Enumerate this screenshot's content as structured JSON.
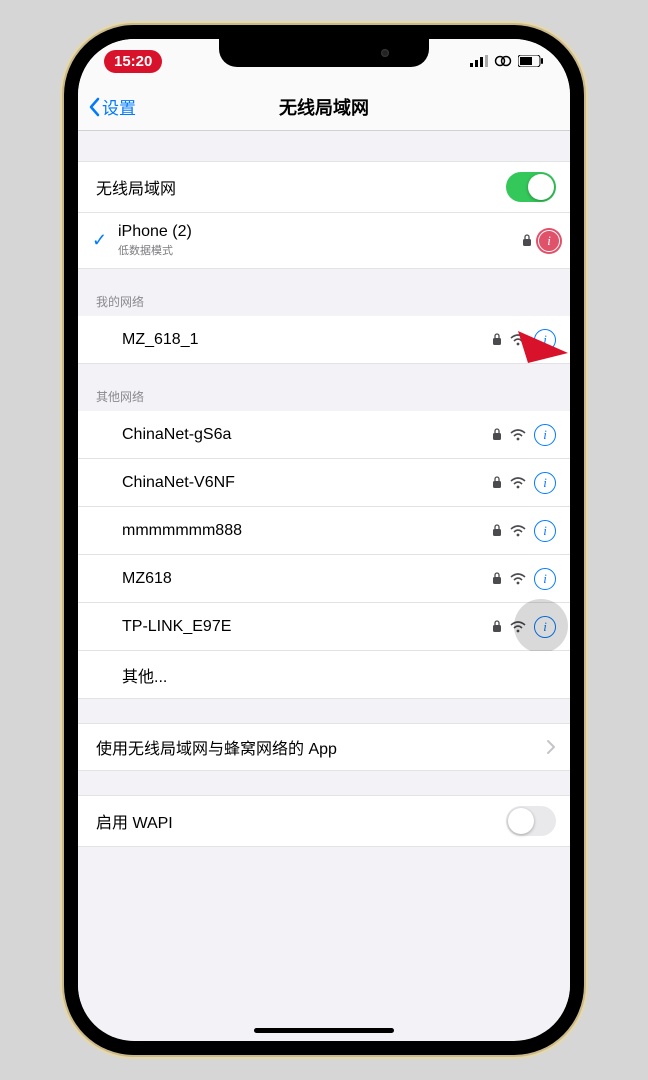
{
  "status": {
    "time": "15:20"
  },
  "nav": {
    "back": "设置",
    "title": "无线局域网"
  },
  "wifi": {
    "label": "无线局域网",
    "enabled": true,
    "connected": {
      "name": "iPhone (2)",
      "mode": "低数据模式"
    }
  },
  "sections": {
    "mine_header": "我的网络",
    "mine": [
      {
        "name": "MZ_618_1",
        "locked": true
      }
    ],
    "others_header": "其他网络",
    "others": [
      {
        "name": "ChinaNet-gS6a",
        "locked": true
      },
      {
        "name": "ChinaNet-V6NF",
        "locked": true
      },
      {
        "name": "mmmmmmm888",
        "locked": true
      },
      {
        "name": "MZ618",
        "locked": true
      },
      {
        "name": "TP-LINK_E97E",
        "locked": true
      }
    ],
    "other_label": "其他..."
  },
  "apps_row": "使用无线局域网与蜂窝网络的 App",
  "wapi_row": "启用 WAPI"
}
